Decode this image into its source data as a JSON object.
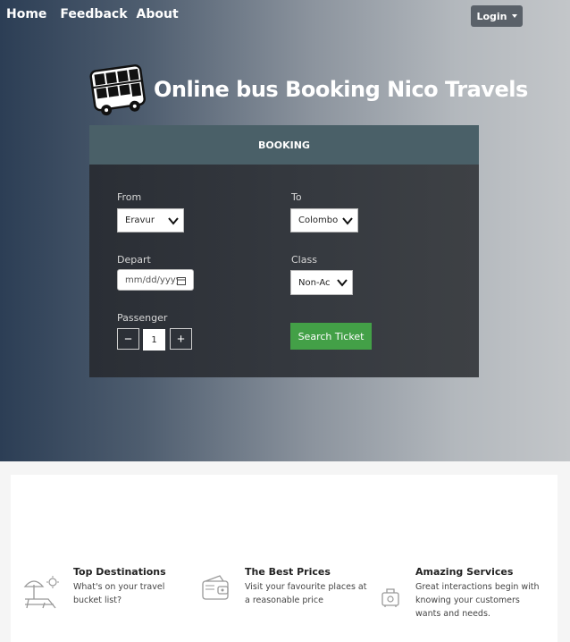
{
  "nav": {
    "items": [
      {
        "label": "Home"
      },
      {
        "label": "Feedback"
      },
      {
        "label": "About"
      }
    ],
    "login_label": "Login"
  },
  "brand": {
    "title": "Online bus Booking Nico Travels",
    "icon": "bus-icon"
  },
  "booking": {
    "header": "BOOKING",
    "from": {
      "label": "From",
      "value": "Eravur"
    },
    "to": {
      "label": "To",
      "value": "Colombo"
    },
    "depart": {
      "label": "Depart",
      "placeholder": "mm/dd/yyyy"
    },
    "class": {
      "label": "Class",
      "value": "Non-Ac"
    },
    "passenger": {
      "label": "Passenger",
      "value": "1",
      "minus": "−",
      "plus": "+"
    },
    "search_label": "Search Ticket"
  },
  "features": [
    {
      "title": "Top Destinations",
      "desc": "What's on your travel bucket list?",
      "icon": "beach-chair-icon"
    },
    {
      "title": "The Best Prices",
      "desc": "Visit your favourite places at a reasonable price",
      "icon": "wallet-icon"
    },
    {
      "title": "Amazing Services",
      "desc": "Great interactions begin with knowing your customers wants and needs.",
      "icon": "luggage-icon"
    }
  ],
  "colors": {
    "search_button": "#43a047",
    "booking_header": "#4a6068"
  }
}
